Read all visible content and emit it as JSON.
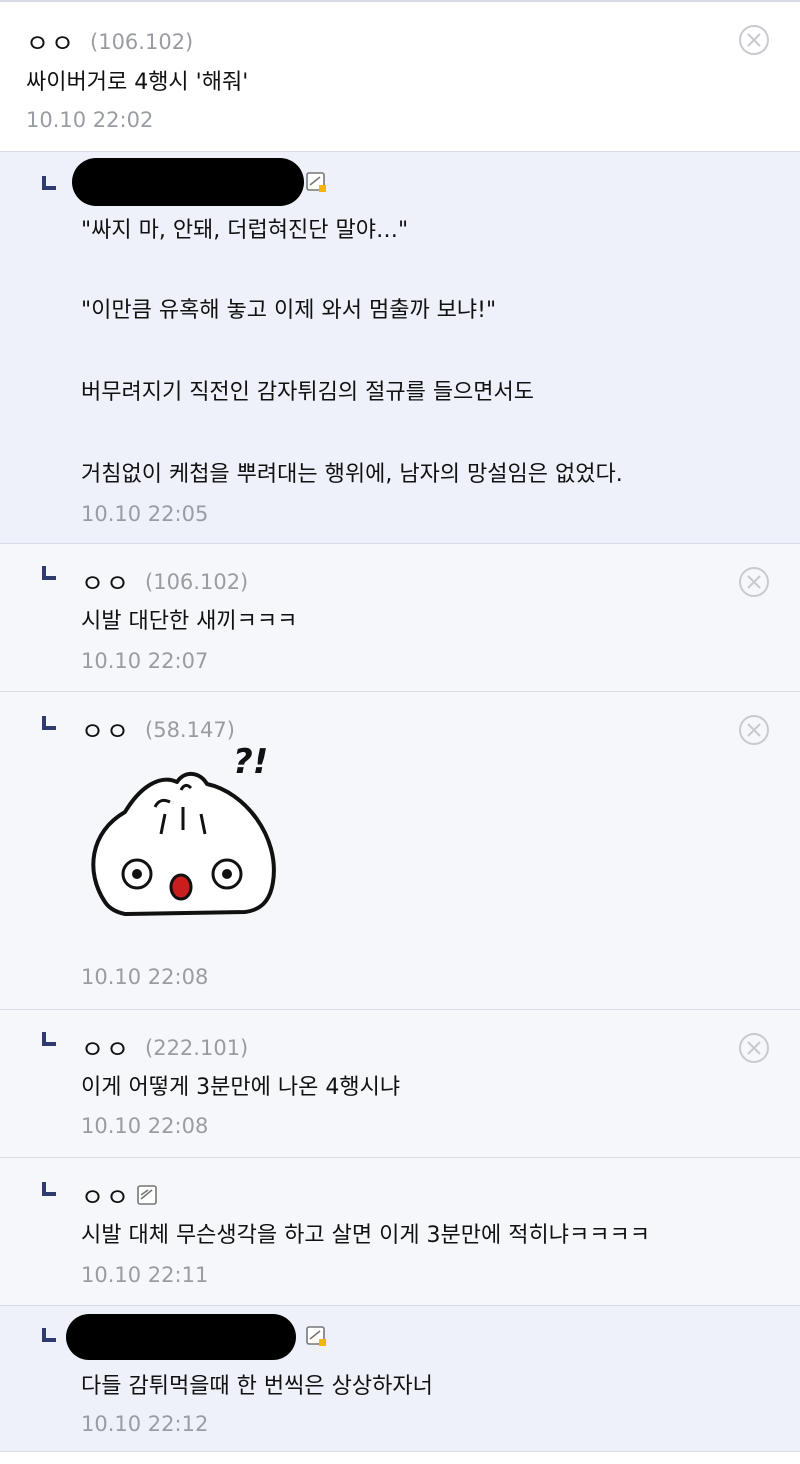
{
  "comments": [
    {
      "nick": "ㅇㅇ",
      "ip": "(106.102)",
      "text": "싸이버거로 4행시 '해줘'",
      "date": "10.10 22:02"
    },
    {
      "lines": [
        "\"싸지 마, 안돼, 더럽혀진단 말야…\"",
        "\"이만큼 유혹해 놓고 이제 와서 멈출까 보냐!\"",
        "버무려지기 직전인 감자튀김의 절규를 들으면서도",
        "거침없이 케첩을 뿌려대는 행위에, 남자의 망설임은 없었다."
      ],
      "date": "10.10 22:05"
    },
    {
      "nick": "ㅇㅇ",
      "ip": "(106.102)",
      "text": "시발 대단한 새끼ㅋㅋㅋ",
      "date": "10.10 22:07"
    },
    {
      "nick": "ㅇㅇ",
      "ip": "(58.147)",
      "sticker_text": "?!",
      "date": "10.10 22:08"
    },
    {
      "nick": "ㅇㅇ",
      "ip": "(222.101)",
      "text": "이게 어떻게 3분만에 나온 4행시냐",
      "date": "10.10 22:08"
    },
    {
      "nick": "ㅇㅇ",
      "text": "시발 대체 무슨생각을 하고 살면 이게 3분만에 적히냐ㅋㅋㅋㅋ",
      "date": "10.10 22:11"
    },
    {
      "text": "다들 감튀먹을때 한 번씩은 상상하자너",
      "date": "10.10 22:12"
    }
  ],
  "icons": {
    "delete": "circle-x-icon",
    "reply": "reply-corner-icon",
    "member": "member-badge-icon"
  },
  "colors": {
    "reply_mark": "#2f3a6e",
    "meta_gray": "#9a9ca3",
    "highlight_bg": "#eef1f9"
  }
}
